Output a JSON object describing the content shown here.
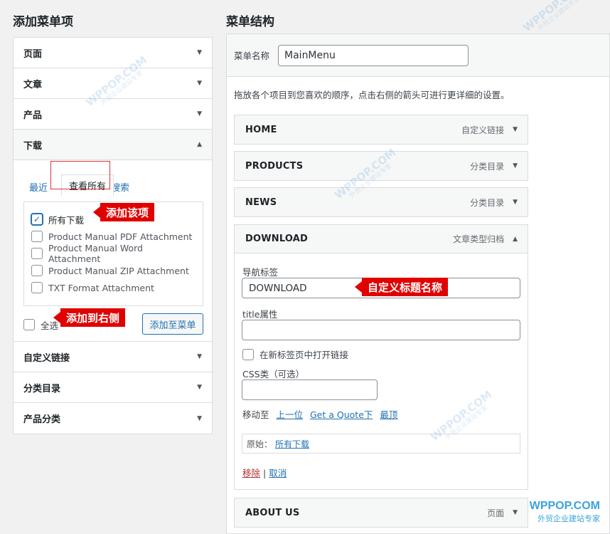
{
  "left": {
    "title": "添加菜单项",
    "accordion_top": [
      "页面",
      "文章",
      "产品"
    ],
    "download": {
      "label": "下载",
      "tabs": [
        "最近",
        "查看所有",
        "搜索"
      ],
      "items": [
        "所有下载",
        "Product Manual PDF Attachment",
        "Product Manual Word Attachment",
        "Product Manual ZIP Attachment",
        "TXT Format Attachment"
      ],
      "select_all": "全选",
      "add_button": "添加至菜单"
    },
    "accordion_bottom": [
      "自定义链接",
      "分类目录",
      "产品分类"
    ]
  },
  "callouts": {
    "add_item": "添加该项",
    "add_right": "添加到右侧",
    "custom_title": "自定义标题名称"
  },
  "right": {
    "title": "菜单结构",
    "menu_name_label": "菜单名称",
    "menu_name_value": "MainMenu",
    "intro": "拖放各个项目到您喜欢的顺序，点击右侧的箭头可进行更详细的设置。",
    "items": [
      {
        "title": "HOME",
        "type": "自定义链接"
      },
      {
        "title": "PRODUCTS",
        "type": "分类目录"
      },
      {
        "title": "NEWS",
        "type": "分类目录"
      }
    ],
    "open_item": {
      "title": "DOWNLOAD",
      "type": "文章类型归档",
      "nav_label": "导航标签",
      "nav_value": "DOWNLOAD",
      "title_attr_label": "title属性",
      "new_tab_label": "在新标签页中打开链接",
      "css_label": "CSS类（可选）",
      "move_to": "移动至",
      "move_up": "上一位",
      "move_under": "Get a Quote下",
      "move_top": "最顶",
      "original_label": "原始：",
      "original_link": "所有下载",
      "remove": "移除",
      "separator": "|",
      "cancel": "取消"
    },
    "last_item": {
      "title": "ABOUT US",
      "type": "页面"
    }
  },
  "watermark": {
    "name": "WPPOP.COM",
    "tagline": "外贸企业建站专家"
  },
  "brand": {
    "name": "WPPOP.COM",
    "tagline": "外贸企业建站专家"
  }
}
